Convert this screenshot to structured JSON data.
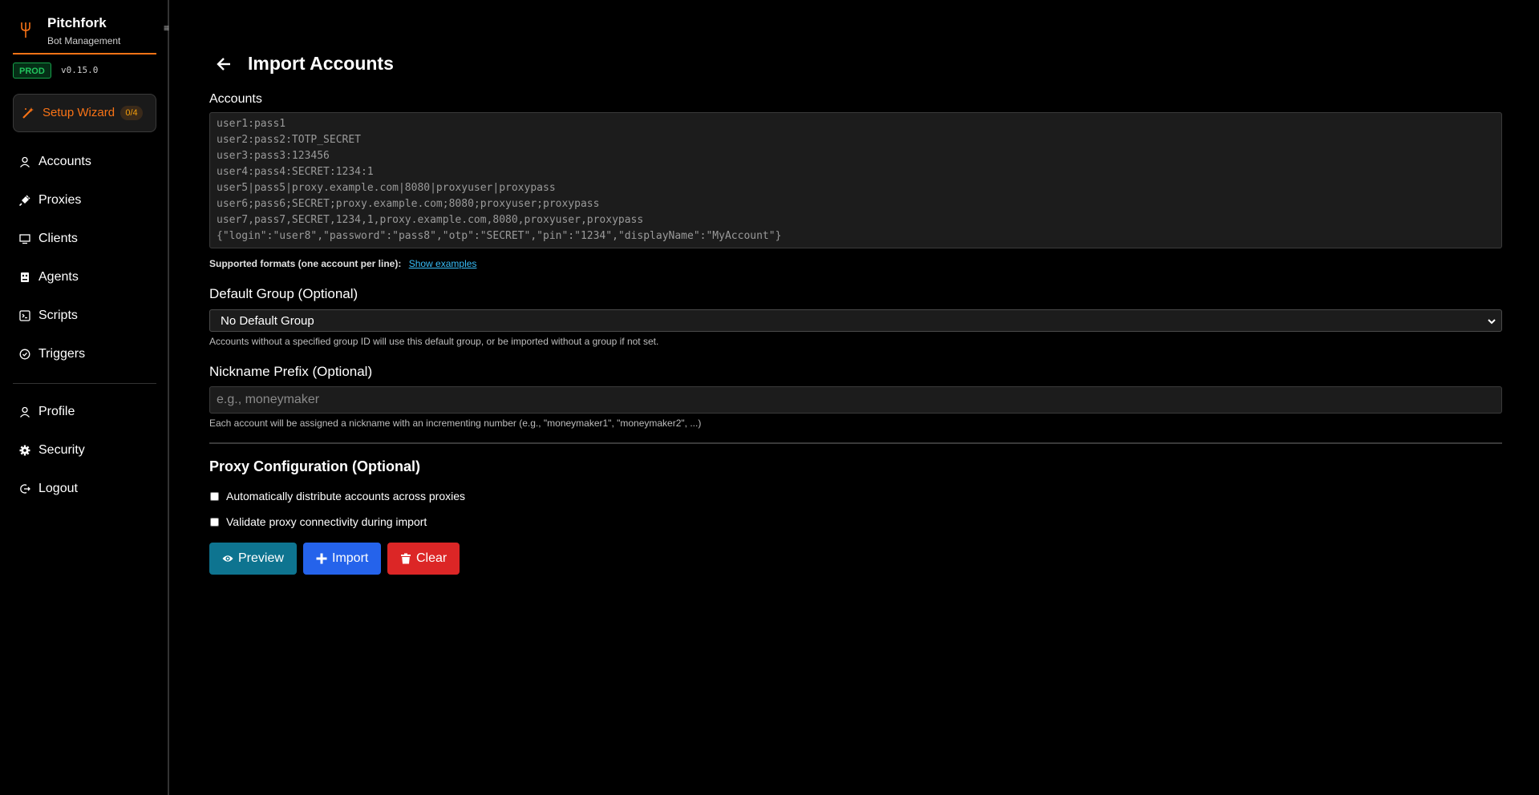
{
  "app": {
    "title": "Pitchfork",
    "subtitle": "Bot Management",
    "env": "PROD",
    "version": "v0.15.0"
  },
  "colors": {
    "accent": "#f97316",
    "preview": "#0e7490",
    "import": "#2563eb",
    "clear": "#dc2626",
    "env": "#22c55e"
  },
  "sidebar": {
    "collapse_icon": "≡",
    "wizard": {
      "label": "Setup Wizard",
      "count": "0/4",
      "icon": "magic-wand-icon"
    },
    "items": [
      {
        "label": "Accounts",
        "icon": "user-icon"
      },
      {
        "label": "Proxies",
        "icon": "plug-icon"
      },
      {
        "label": "Clients",
        "icon": "monitor-icon"
      },
      {
        "label": "Agents",
        "icon": "robot-icon"
      },
      {
        "label": "Scripts",
        "icon": "terminal-icon"
      },
      {
        "label": "Triggers",
        "icon": "check-circle-icon"
      }
    ],
    "bottom_items": [
      {
        "label": "Profile",
        "icon": "user-icon"
      },
      {
        "label": "Security",
        "icon": "gear-icon"
      },
      {
        "label": "Logout",
        "icon": "logout-icon"
      }
    ]
  },
  "page": {
    "title": "Import Accounts",
    "accounts_label": "Accounts",
    "accounts_placeholder": "user1:pass1\nuser2:pass2:TOTP_SECRET\nuser3:pass3:123456\nuser4:pass4:SECRET:1234:1\nuser5|pass5|proxy.example.com|8080|proxyuser|proxypass\nuser6;pass6;SECRET;proxy.example.com;8080;proxyuser;proxypass\nuser7,pass7,SECRET,1234,1,proxy.example.com,8080,proxyuser,proxypass\n{\"login\":\"user8\",\"password\":\"pass8\",\"otp\":\"SECRET\",\"pin\":\"1234\",\"displayName\":\"MyAccount\"}",
    "formats_text": "Supported formats (one account per line):",
    "show_examples": "Show examples",
    "group_label": "Default Group (Optional)",
    "group_value": "No Default Group",
    "group_help": "Accounts without a specified group ID will use this default group, or be imported without a group if not set.",
    "prefix_label": "Nickname Prefix (Optional)",
    "prefix_placeholder": "e.g., moneymaker",
    "prefix_help": "Each account will be assigned a nickname with an incrementing number (e.g., \"moneymaker1\", \"moneymaker2\", ...)",
    "proxy_title": "Proxy Configuration (Optional)",
    "distribute_label": "Automatically distribute accounts across proxies",
    "validate_label": "Validate proxy connectivity during import",
    "buttons": {
      "preview": "Preview",
      "import": "Import",
      "clear": "Clear"
    }
  }
}
